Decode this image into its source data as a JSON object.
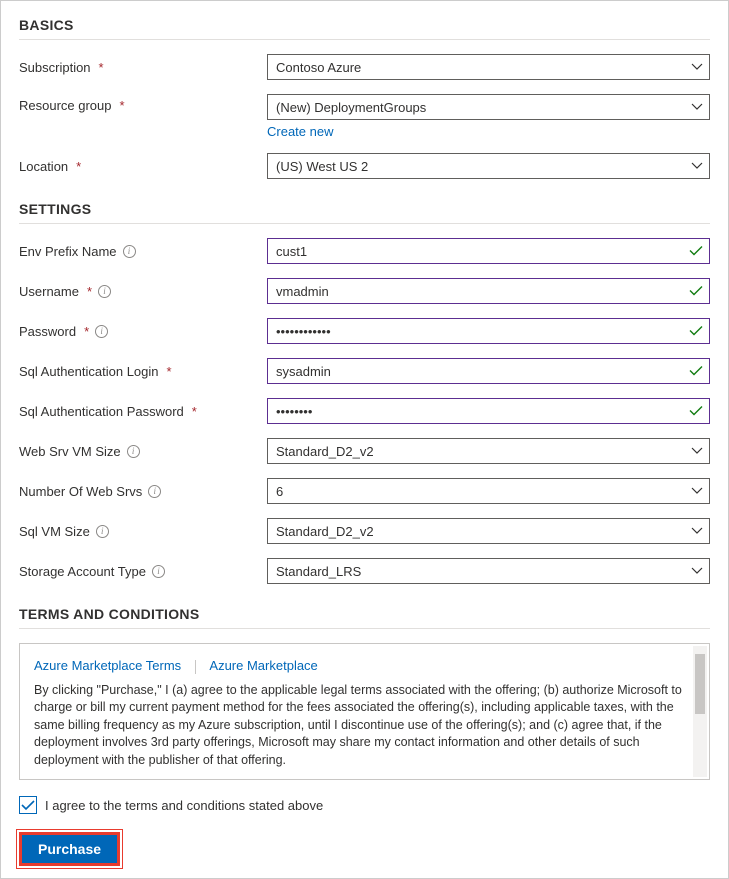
{
  "sections": {
    "basics_title": "BASICS",
    "settings_title": "SETTINGS",
    "terms_title": "TERMS AND CONDITIONS"
  },
  "basics": {
    "subscription_label": "Subscription",
    "subscription_value": "Contoso Azure",
    "resource_group_label": "Resource group",
    "resource_group_value": "(New) DeploymentGroups",
    "create_new_link": "Create new",
    "location_label": "Location",
    "location_value": "(US) West US 2"
  },
  "settings": {
    "env_prefix_label": "Env Prefix Name",
    "env_prefix_value": "cust1",
    "username_label": "Username",
    "username_value": "vmadmin",
    "password_label": "Password",
    "password_value": "••••••••••••",
    "sql_login_label": "Sql Authentication Login",
    "sql_login_value": "sysadmin",
    "sql_password_label": "Sql Authentication Password",
    "sql_password_value": "••••••••",
    "web_vm_size_label": "Web Srv VM Size",
    "web_vm_size_value": "Standard_D2_v2",
    "num_web_srvs_label": "Number Of Web Srvs",
    "num_web_srvs_value": "6",
    "sql_vm_size_label": "Sql VM Size",
    "sql_vm_size_value": "Standard_D2_v2",
    "storage_type_label": "Storage Account Type",
    "storage_type_value": "Standard_LRS"
  },
  "terms": {
    "link_terms": "Azure Marketplace Terms",
    "link_marketplace": "Azure Marketplace",
    "body": "By clicking \"Purchase,\" I (a) agree to the applicable legal terms associated with the offering; (b) authorize Microsoft to charge or bill my current payment method for the fees associated the offering(s), including applicable taxes, with the same billing frequency as my Azure subscription, until I discontinue use of the offering(s); and (c) agree that, if the deployment involves 3rd party offerings, Microsoft may share my contact information and other details of such deployment with the publisher of that offering.",
    "agree_label": "I agree to the terms and conditions stated above",
    "agree_checked": true
  },
  "actions": {
    "purchase_label": "Purchase"
  }
}
